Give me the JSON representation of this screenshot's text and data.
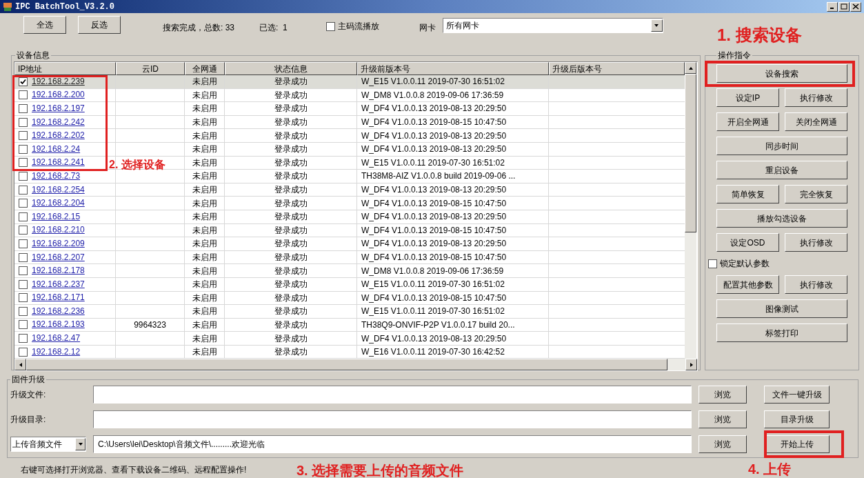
{
  "window": {
    "title": "IPC BatchTool_V3.2.0"
  },
  "toolbar": {
    "buttons": [
      "全选",
      "反选"
    ],
    "search_status": "搜索完成，总数: 33",
    "selected_count": "已选:  1",
    "main_stream": {
      "label": "主码流播放",
      "checked": false
    },
    "nic_label": "网卡",
    "nic_value": "所有网卡"
  },
  "device_group": {
    "title": "设备信息",
    "columns": [
      "IP地址",
      "云ID",
      "全网通",
      "状态信息",
      "升级前版本号",
      "升级后版本号"
    ],
    "rows": [
      {
        "ip": "192.168.2.239",
        "cloud_id": "",
        "p2p": "未启用",
        "status": "登录成功",
        "version_before": "W_E15 V1.0.0.11 2019-07-30 16:51:02",
        "checked": true,
        "selected": true
      },
      {
        "ip": "192.168.2.200",
        "cloud_id": "",
        "p2p": "未启用",
        "status": "登录成功",
        "version_before": "W_DM8 V1.0.0.8 2019-09-06 17:36:59",
        "checked": false,
        "selected": false
      },
      {
        "ip": "192.168.2.197",
        "cloud_id": "",
        "p2p": "未启用",
        "status": "登录成功",
        "version_before": "W_DF4 V1.0.0.13 2019-08-13 20:29:50",
        "checked": false,
        "selected": false
      },
      {
        "ip": "192.168.2.242",
        "cloud_id": "",
        "p2p": "未启用",
        "status": "登录成功",
        "version_before": "W_DF4 V1.0.0.13 2019-08-15 10:47:50",
        "checked": false,
        "selected": false
      },
      {
        "ip": "192.168.2.202",
        "cloud_id": "",
        "p2p": "未启用",
        "status": "登录成功",
        "version_before": "W_DF4 V1.0.0.13 2019-08-13 20:29:50",
        "checked": false,
        "selected": false
      },
      {
        "ip": "192.168.2.24",
        "cloud_id": "",
        "p2p": "未启用",
        "status": "登录成功",
        "version_before": "W_DF4 V1.0.0.13 2019-08-13 20:29:50",
        "checked": false,
        "selected": false
      },
      {
        "ip": "192.168.2.241",
        "cloud_id": "",
        "p2p": "未启用",
        "status": "登录成功",
        "version_before": "W_E15 V1.0.0.11 2019-07-30 16:51:02",
        "checked": false,
        "selected": false
      },
      {
        "ip": "192.168.2.73",
        "cloud_id": "",
        "p2p": "未启用",
        "status": "登录成功",
        "version_before": "TH38M8-AIZ V1.0.0.8 build 2019-09-06 ...",
        "checked": false,
        "selected": false
      },
      {
        "ip": "192.168.2.254",
        "cloud_id": "",
        "p2p": "未启用",
        "status": "登录成功",
        "version_before": "W_DF4 V1.0.0.13 2019-08-13 20:29:50",
        "checked": false,
        "selected": false
      },
      {
        "ip": "192.168.2.204",
        "cloud_id": "",
        "p2p": "未启用",
        "status": "登录成功",
        "version_before": "W_DF4 V1.0.0.13 2019-08-15 10:47:50",
        "checked": false,
        "selected": false
      },
      {
        "ip": "192.168.2.15",
        "cloud_id": "",
        "p2p": "未启用",
        "status": "登录成功",
        "version_before": "W_DF4 V1.0.0.13 2019-08-13 20:29:50",
        "checked": false,
        "selected": false
      },
      {
        "ip": "192.168.2.210",
        "cloud_id": "",
        "p2p": "未启用",
        "status": "登录成功",
        "version_before": "W_DF4 V1.0.0.13 2019-08-15 10:47:50",
        "checked": false,
        "selected": false
      },
      {
        "ip": "192.168.2.209",
        "cloud_id": "",
        "p2p": "未启用",
        "status": "登录成功",
        "version_before": "W_DF4 V1.0.0.13 2019-08-13 20:29:50",
        "checked": false,
        "selected": false
      },
      {
        "ip": "192.168.2.207",
        "cloud_id": "",
        "p2p": "未启用",
        "status": "登录成功",
        "version_before": "W_DF4 V1.0.0.13 2019-08-15 10:47:50",
        "checked": false,
        "selected": false
      },
      {
        "ip": "192.168.2.178",
        "cloud_id": "",
        "p2p": "未启用",
        "status": "登录成功",
        "version_before": "W_DM8 V1.0.0.8 2019-09-06 17:36:59",
        "checked": false,
        "selected": false
      },
      {
        "ip": "192.168.2.237",
        "cloud_id": "",
        "p2p": "未启用",
        "status": "登录成功",
        "version_before": "W_E15 V1.0.0.11 2019-07-30 16:51:02",
        "checked": false,
        "selected": false
      },
      {
        "ip": "192.168.2.171",
        "cloud_id": "",
        "p2p": "未启用",
        "status": "登录成功",
        "version_before": "W_DF4 V1.0.0.13 2019-08-15 10:47:50",
        "checked": false,
        "selected": false
      },
      {
        "ip": "192.168.2.236",
        "cloud_id": "",
        "p2p": "未启用",
        "status": "登录成功",
        "version_before": "W_E15 V1.0.0.11 2019-07-30 16:51:02",
        "checked": false,
        "selected": false
      },
      {
        "ip": "192.168.2.193",
        "cloud_id": "9964323",
        "p2p": "未启用",
        "status": "登录成功",
        "version_before": "TH38Q9-ONVIF-P2P V1.0.0.17 build 20...",
        "checked": false,
        "selected": false
      },
      {
        "ip": "192.168.2.47",
        "cloud_id": "",
        "p2p": "未启用",
        "status": "登录成功",
        "version_before": "W_DF4 V1.0.0.13 2019-08-13 20:29:50",
        "checked": false,
        "selected": false
      },
      {
        "ip": "192.168.2.12",
        "cloud_id": "",
        "p2p": "未启用",
        "status": "登录成功",
        "version_before": "W_E16 V1.0.0.11 2019-07-30 16:42:52",
        "checked": false,
        "selected": false
      }
    ]
  },
  "commands": {
    "title": "操作指令",
    "items": [
      {
        "kind": "button",
        "label": "设备搜索"
      },
      {
        "kind": "pair",
        "labels": [
          "设定IP",
          "执行修改"
        ]
      },
      {
        "kind": "pair",
        "labels": [
          "开启全网通",
          "关闭全网通"
        ]
      },
      {
        "kind": "button",
        "label": "同步时间"
      },
      {
        "kind": "button",
        "label": "重启设备"
      },
      {
        "kind": "pair",
        "labels": [
          "简单恢复",
          "完全恢复"
        ]
      },
      {
        "kind": "button",
        "label": "播放勾选设备"
      },
      {
        "kind": "pair",
        "labels": [
          "设定OSD",
          "执行修改"
        ]
      },
      {
        "kind": "checkbox",
        "label": "锁定默认参数",
        "checked": false
      },
      {
        "kind": "pair",
        "labels": [
          "配置其他参数",
          "执行修改"
        ]
      },
      {
        "kind": "button",
        "label": "图像测试"
      },
      {
        "kind": "button",
        "label": "标签打印"
      }
    ]
  },
  "firmware": {
    "title": "固件升级",
    "rows": [
      {
        "kind": "label",
        "label": "升级文件:",
        "value": "",
        "browse": "浏览",
        "action": "文件一键升级"
      },
      {
        "kind": "label",
        "label": "升级目录:",
        "value": "",
        "browse": "浏览",
        "action": "目录升级"
      },
      {
        "kind": "select",
        "label": "上传音频文件",
        "value": "C:\\Users\\lei\\Desktop\\音频文件\\.........欢迎光临",
        "browse": "浏览",
        "action": "开始上传"
      }
    ]
  },
  "status_bar": "右键可选择打开浏览器、查看下载设备二维码、远程配置操作!",
  "annotations": [
    "1. 搜索设备",
    "2. 选择设备",
    "3. 选择需要上传的音频文件",
    "4. 上传"
  ]
}
